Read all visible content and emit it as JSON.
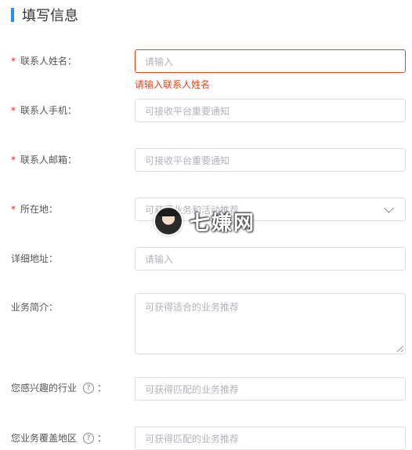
{
  "section": {
    "title": "填写信息"
  },
  "form": {
    "contact_name": {
      "label": "联系人姓名：",
      "required": "*",
      "placeholder": "请输入",
      "error": "请输入联系人姓名"
    },
    "contact_phone": {
      "label": "联系人手机：",
      "required": "*",
      "placeholder": "可接收平台重要通知"
    },
    "contact_email": {
      "label": "联系人邮箱：",
      "required": "*",
      "placeholder": "可接收平台重要通知"
    },
    "location": {
      "label": "所在地：",
      "required": "*",
      "placeholder": "可获得业务和活动推荐"
    },
    "address": {
      "label": "详细地址：",
      "placeholder": "请输入"
    },
    "intro": {
      "label": "业务简介：",
      "placeholder": "可获得适合的业务推荐"
    },
    "industry": {
      "label": "您感兴趣的行业",
      "help": "?",
      "colon": "：",
      "placeholder": "可获得匹配的业务推荐"
    },
    "coverage": {
      "label": "您业务覆盖地区",
      "help": "?",
      "colon": "：",
      "placeholder": "可获得匹配的业务推荐"
    }
  },
  "watermark": {
    "text": "七嫌网"
  },
  "icons": {
    "dropdown": "chevron-down-icon",
    "help": "question-circle-icon",
    "required": "asterisk"
  },
  "colors": {
    "accent": "#2d8cf0",
    "error": "#ed4014",
    "required": "#e2231a",
    "border": "#dcdee2"
  }
}
